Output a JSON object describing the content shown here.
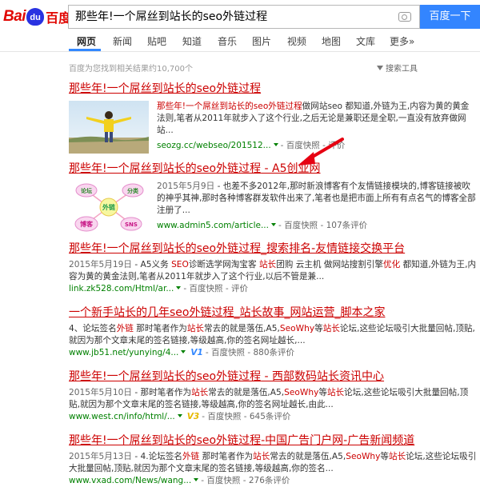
{
  "logo": {
    "bai": "Bai",
    "du": "du",
    "cn": "百度"
  },
  "search": {
    "query": "那些年!一个屌丝到站长的seo外链过程",
    "button": "百度一下"
  },
  "nav": {
    "tabs": [
      "网页",
      "新闻",
      "贴吧",
      "知道",
      "音乐",
      "图片",
      "视频",
      "地图",
      "文库",
      "更多»"
    ]
  },
  "stats": {
    "text": "百度为您找到相关结果约10,700个",
    "tools": "搜索工具"
  },
  "results": [
    {
      "title": "那些年!一个屌丝到站长的seo外链过程",
      "body_em": "那些年!一个屌丝到站长的seo外链过程",
      "body": "做网站seo 都知道,外链为王,内容为黄的黄金法则,笔者从2011年就步入了这个行业,之后无论是兼职还是全职,一直没有放弃做网站...",
      "url": "seozg.cc/webseo/201512...",
      "snapshot": "百度快照",
      "review": "评价"
    },
    {
      "title": "那些年!一个屌丝到站长的seo外链过程",
      "title_suffix": " - A5创业网",
      "date": "2015年5月9日",
      "body": " - 也差不多2012年,那时新浪博客有个友情链接模块的,博客链接被吹的神乎其神,那时各种博客群发软件出来了,笔者也是把市面上所有有点名气的博客全部注册了...",
      "url": "www.admin5.com/article...",
      "snapshot": "百度快照",
      "review_count": "107条评价",
      "thumb_labels": {
        "a": "论坛",
        "b": "分类",
        "c": "外链",
        "d": "博客",
        "e": "SNS"
      }
    },
    {
      "title": "那些年!一个屌丝到站长的seo外链过程",
      "title_suffix": "_搜索排名-友情链接交换平台",
      "date": "2015年5月19日",
      "body_parts": [
        " - A5义务 ",
        "SEO",
        "诊断选学网淘宝客 ",
        "站长",
        "团购 云主机 做网站搜割引擎",
        "优化",
        " 都知道,外链为王,内容为黄的黄金法则,笔者从2011年就步入了这个行业,以后不管是兼..."
      ],
      "url": "link.zk528.com/Html/ar...",
      "snapshot": "百度快照",
      "review": "评价"
    },
    {
      "title": "一个新手站长的几年seo外链过程",
      "title_suffix": "_站长故事_网站运营_脚本之家",
      "body_parts": [
        "4、论坛签名",
        "外链",
        " 那时笔者作为",
        "站长",
        "常去的就是落伍,A5,",
        "SeoWhy",
        "等",
        "站长",
        "论坛,这些论坛吸引大批量回帖,顶贴,就因为那个文章末尾的签名链接,等级越高,你的签名网址越长,..."
      ],
      "url": "www.jb51.net/yunying/4...",
      "badge": "V1",
      "snapshot": "百度快照",
      "review_count": "880条评价"
    },
    {
      "title": "那些年!一个屌丝到站长的seo外链过程",
      "title_suffix": " - 西部数码站长资讯中心",
      "date": "2015年5月10日",
      "body_parts": [
        " - 那时笔者作为",
        "站长",
        "常去的就是落伍,A5,",
        "SeoWhy",
        "等",
        "站长",
        "论坛,这些论坛吸引大批量回帖,顶贴,就因为那个文章末尾的签名链接,等级越高,你的签名网址越长,由此..."
      ],
      "url": "www.west.cn/info/html/...",
      "badge": "V3",
      "snapshot": "百度快照",
      "review_count": "645条评价"
    },
    {
      "title": "那些年!一个屌丝到站长的seo外链过程",
      "title_suffix": "-中国广告门户网-广告新闻频道",
      "date": "2015年5月13日",
      "body_parts": [
        " - 4.论坛签名",
        "外链",
        " 那时笔者作为",
        "站长",
        "常去的就是落伍,A5,",
        "SeoWhy",
        "等",
        "站长",
        "论坛,这些论坛吸引大批量回帖,顶贴,就因为那个文章末尾的签名链接,等级越高,你的签名..."
      ],
      "url": "www.vxad.com/News/wang...",
      "snapshot": "百度快照",
      "review_count": "276条评价"
    }
  ],
  "colors": {
    "accent": "#3385ff",
    "title_red": "#cc0000",
    "url_green": "#008000"
  }
}
